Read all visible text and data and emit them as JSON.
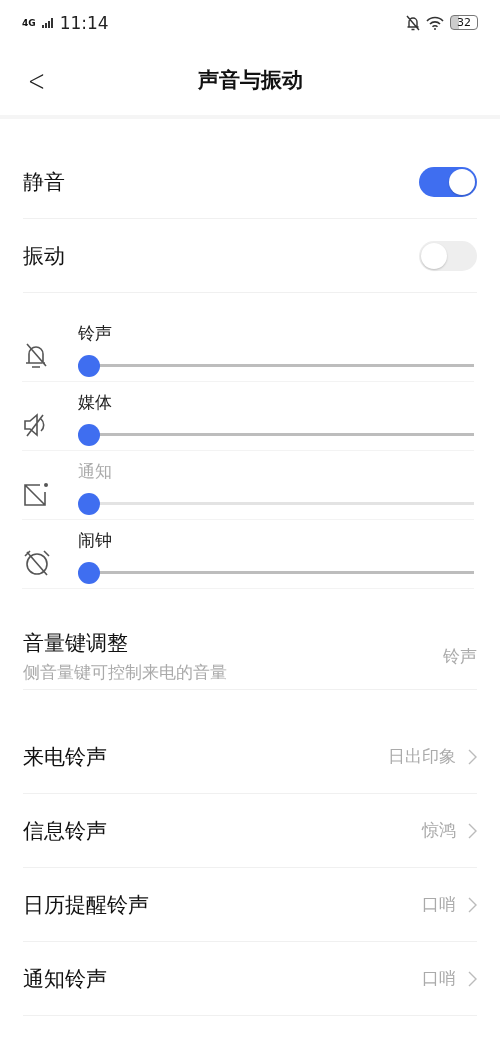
{
  "status_bar": {
    "network": "4G",
    "time": "11:14",
    "battery": "32"
  },
  "header": {
    "back": "<",
    "title": "声音与振动"
  },
  "toggles": [
    {
      "label": "静音",
      "on": true
    },
    {
      "label": "振动",
      "on": false
    }
  ],
  "volumes": [
    {
      "kind": "bell",
      "label": "铃声",
      "level": 0,
      "disabled": false
    },
    {
      "kind": "media",
      "label": "媒体",
      "level": 0,
      "disabled": false
    },
    {
      "kind": "notification",
      "label": "通知",
      "level": 0,
      "disabled": true
    },
    {
      "kind": "alarm",
      "label": "闹钟",
      "level": 0,
      "disabled": false
    }
  ],
  "volume_key": {
    "title": "音量键调整",
    "subtitle": "侧音量键可控制来电的音量",
    "value": "铃声"
  },
  "ringtones": [
    {
      "label": "来电铃声",
      "value": "日出印象"
    },
    {
      "label": "信息铃声",
      "value": "惊鸿"
    },
    {
      "label": "日历提醒铃声",
      "value": "口哨"
    },
    {
      "label": "通知铃声",
      "value": "口哨"
    }
  ]
}
